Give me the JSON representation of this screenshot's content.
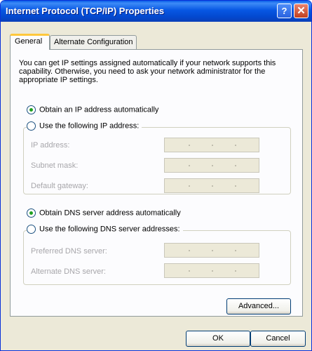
{
  "window": {
    "title": "Internet Protocol (TCP/IP) Properties",
    "help_glyph": "?",
    "close_glyph": "✕"
  },
  "tabs": [
    "General",
    "Alternate Configuration"
  ],
  "description": "You can get IP settings assigned automatically if your network supports this capability. Otherwise, you need to ask your network administrator for the appropriate IP settings.",
  "ip_section": {
    "auto_label": "Obtain an IP address automatically",
    "manual_label": "Use the following IP address:",
    "selected": "auto",
    "fields": [
      "IP address:",
      "Subnet mask:",
      "Default gateway:"
    ]
  },
  "dns_section": {
    "auto_label": "Obtain DNS server address automatically",
    "manual_label": "Use the following DNS server addresses:",
    "selected": "auto",
    "fields": [
      "Preferred DNS server:",
      "Alternate DNS server:"
    ]
  },
  "buttons": {
    "advanced": "Advanced...",
    "ok": "OK",
    "cancel": "Cancel"
  },
  "colors": {
    "titlebar": "#0757e3",
    "dialog_bg": "#ece9d8",
    "panel_bg": "#fcfcfe",
    "radio_dot": "#21a121",
    "disabled_text": "#a7a6aa"
  }
}
